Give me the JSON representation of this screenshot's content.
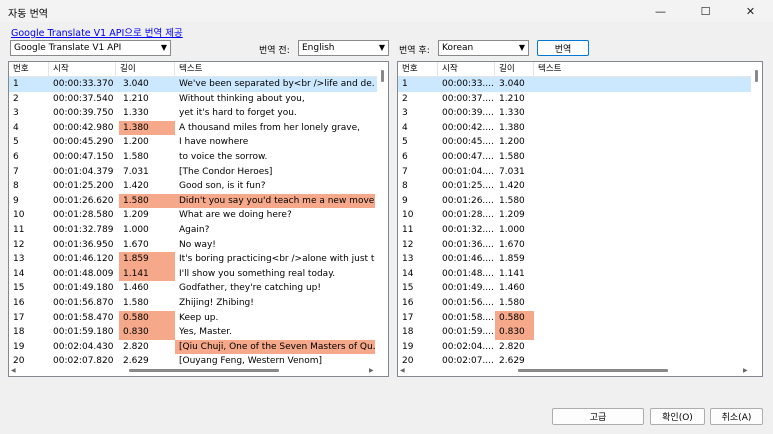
{
  "window": {
    "title": "자동 번역"
  },
  "link": {
    "text": "Google Translate V1 API으로 번역 제공"
  },
  "engine": {
    "selected": "Google Translate V1 API"
  },
  "source_lang": {
    "label": "번역 전:",
    "selected": "English"
  },
  "target_lang": {
    "label": "번역 후:",
    "selected": "Korean"
  },
  "buttons": {
    "translate": "번역",
    "advanced": "고급",
    "ok": "확인(O)",
    "cancel": "취소(A)"
  },
  "left_table": {
    "headers": [
      "번호",
      "시작",
      "길이",
      "텍스트"
    ],
    "rows": [
      {
        "no": "1",
        "start": "00:00:33.370",
        "len": "3.040",
        "text": "We've been separated by<br />life and de...",
        "len_hl": false,
        "text_hl": false
      },
      {
        "no": "2",
        "start": "00:00:37.540",
        "len": "1.210",
        "text": "Without thinking about you,",
        "len_hl": false,
        "text_hl": false
      },
      {
        "no": "3",
        "start": "00:00:39.750",
        "len": "1.330",
        "text": "yet it's hard to forget you.",
        "len_hl": false,
        "text_hl": false
      },
      {
        "no": "4",
        "start": "00:00:42.980",
        "len": "1.380",
        "text": "A thousand miles from her lonely grave,",
        "len_hl": true,
        "text_hl": false
      },
      {
        "no": "5",
        "start": "00:00:45.290",
        "len": "1.200",
        "text": "I have nowhere",
        "len_hl": false,
        "text_hl": false
      },
      {
        "no": "6",
        "start": "00:00:47.150",
        "len": "1.580",
        "text": "to voice the sorrow.",
        "len_hl": false,
        "text_hl": false
      },
      {
        "no": "7",
        "start": "00:01:04.379",
        "len": "7.031",
        "text": "[The Condor Heroes]",
        "len_hl": false,
        "text_hl": false
      },
      {
        "no": "8",
        "start": "00:01:25.200",
        "len": "1.420",
        "text": "Good son, is it fun?",
        "len_hl": false,
        "text_hl": false
      },
      {
        "no": "9",
        "start": "00:01:26.620",
        "len": "1.580",
        "text": "Didn't you say you'd teach me a new move ...",
        "len_hl": true,
        "text_hl": true
      },
      {
        "no": "10",
        "start": "00:01:28.580",
        "len": "1.209",
        "text": "What are we doing here?",
        "len_hl": false,
        "text_hl": false
      },
      {
        "no": "11",
        "start": "00:01:32.789",
        "len": "1.000",
        "text": "Again?",
        "len_hl": false,
        "text_hl": false
      },
      {
        "no": "12",
        "start": "00:01:36.950",
        "len": "1.670",
        "text": "No way!",
        "len_hl": false,
        "text_hl": false
      },
      {
        "no": "13",
        "start": "00:01:46.120",
        "len": "1.859",
        "text": "It's boring practicing<br />alone with just t...",
        "len_hl": true,
        "text_hl": false
      },
      {
        "no": "14",
        "start": "00:01:48.009",
        "len": "1.141",
        "text": "I'll show you something real today.",
        "len_hl": true,
        "text_hl": false
      },
      {
        "no": "15",
        "start": "00:01:49.180",
        "len": "1.460",
        "text": "Godfather, they're catching up!",
        "len_hl": false,
        "text_hl": false
      },
      {
        "no": "16",
        "start": "00:01:56.870",
        "len": "1.580",
        "text": "Zhijing! Zhibing!",
        "len_hl": false,
        "text_hl": false
      },
      {
        "no": "17",
        "start": "00:01:58.470",
        "len": "0.580",
        "text": "Keep up.",
        "len_hl": true,
        "text_hl": false
      },
      {
        "no": "18",
        "start": "00:01:59.180",
        "len": "0.830",
        "text": "Yes, Master.",
        "len_hl": true,
        "text_hl": false
      },
      {
        "no": "19",
        "start": "00:02:04.430",
        "len": "2.820",
        "text": "[Qiu Chuji, One of the Seven Masters of Qu...",
        "len_hl": false,
        "text_hl": true
      },
      {
        "no": "20",
        "start": "00:02:07.820",
        "len": "2.629",
        "text": "[Ouyang Feng, Western Venom]",
        "len_hl": false,
        "text_hl": false
      }
    ]
  },
  "right_table": {
    "headers": [
      "번호",
      "시작",
      "길이",
      "텍스트"
    ],
    "rows": [
      {
        "no": "1",
        "start": "00:00:33....",
        "len": "3.040",
        "len_hl": false
      },
      {
        "no": "2",
        "start": "00:00:37....",
        "len": "1.210",
        "len_hl": false
      },
      {
        "no": "3",
        "start": "00:00:39....",
        "len": "1.330",
        "len_hl": false
      },
      {
        "no": "4",
        "start": "00:00:42....",
        "len": "1.380",
        "len_hl": false
      },
      {
        "no": "5",
        "start": "00:00:45....",
        "len": "1.200",
        "len_hl": false
      },
      {
        "no": "6",
        "start": "00:00:47....",
        "len": "1.580",
        "len_hl": false
      },
      {
        "no": "7",
        "start": "00:01:04....",
        "len": "7.031",
        "len_hl": false
      },
      {
        "no": "8",
        "start": "00:01:25....",
        "len": "1.420",
        "len_hl": false
      },
      {
        "no": "9",
        "start": "00:01:26....",
        "len": "1.580",
        "len_hl": false
      },
      {
        "no": "10",
        "start": "00:01:28....",
        "len": "1.209",
        "len_hl": false
      },
      {
        "no": "11",
        "start": "00:01:32....",
        "len": "1.000",
        "len_hl": false
      },
      {
        "no": "12",
        "start": "00:01:36....",
        "len": "1.670",
        "len_hl": false
      },
      {
        "no": "13",
        "start": "00:01:46....",
        "len": "1.859",
        "len_hl": false
      },
      {
        "no": "14",
        "start": "00:01:48....",
        "len": "1.141",
        "len_hl": false
      },
      {
        "no": "15",
        "start": "00:01:49....",
        "len": "1.460",
        "len_hl": false
      },
      {
        "no": "16",
        "start": "00:01:56....",
        "len": "1.580",
        "len_hl": false
      },
      {
        "no": "17",
        "start": "00:01:58....",
        "len": "0.580",
        "len_hl": true
      },
      {
        "no": "18",
        "start": "00:01:59....",
        "len": "0.830",
        "len_hl": true
      },
      {
        "no": "19",
        "start": "00:02:04....",
        "len": "2.820",
        "len_hl": false
      },
      {
        "no": "20",
        "start": "00:02:07....",
        "len": "2.629",
        "len_hl": false
      }
    ]
  },
  "colors": {
    "highlight": "#f5a88a",
    "selection": "#cce8ff"
  }
}
